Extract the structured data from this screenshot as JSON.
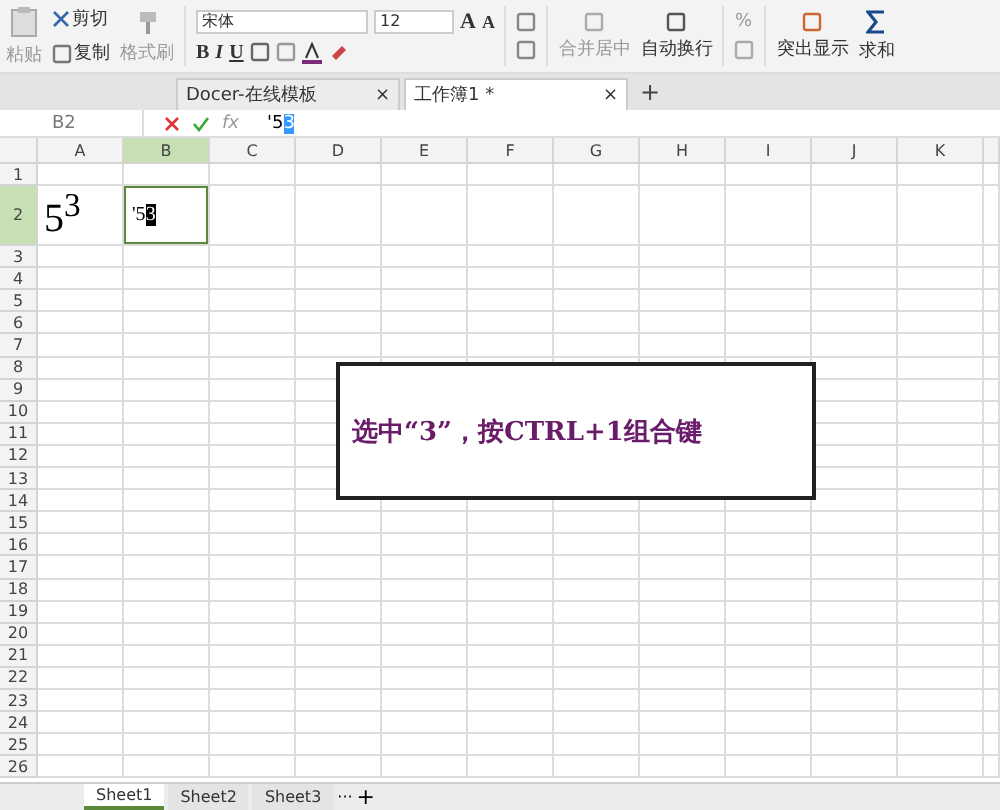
{
  "ribbon": {
    "paste": "粘贴",
    "cut": "剪切",
    "copy": "复制",
    "format_painter": "格式刷",
    "font": "宋体",
    "size": "12",
    "grow": "A",
    "shrink": "A",
    "bold": "B",
    "italic": "I",
    "underline": "U",
    "merge": "合并居中",
    "wrap": "自动换行",
    "percent": "%",
    "highlight": "突出显示",
    "sum": "求和"
  },
  "tabs": [
    {
      "label": "Docer-在线模板",
      "selected": false,
      "close": "×"
    },
    {
      "label": "工作簿1 *",
      "selected": true,
      "close": "×"
    }
  ],
  "new_tab": "+",
  "formula_bar": {
    "cell_ref": "B2",
    "fx": "fx",
    "value": "'5",
    "value_selected": "3"
  },
  "columns": [
    {
      "label": "A",
      "selected": false
    },
    {
      "label": "B",
      "selected": true
    },
    {
      "label": "C",
      "selected": false
    },
    {
      "label": "D",
      "selected": false
    },
    {
      "label": "E",
      "selected": false
    },
    {
      "label": "F",
      "selected": false
    },
    {
      "label": "G",
      "selected": false
    },
    {
      "label": "H",
      "selected": false
    },
    {
      "label": "I",
      "selected": false
    },
    {
      "label": "J",
      "selected": false
    },
    {
      "label": "K",
      "selected": false
    }
  ],
  "rows": [
    {
      "label": "1",
      "selected": false
    },
    {
      "label": "2",
      "selected": true,
      "tall": true,
      "cells": [
        {
          "text": "5$^{3}$",
          "active": false
        },
        {
          "text": "'5",
          "selected_part": "3",
          "active": true
        }
      ]
    },
    {
      "label": "3",
      "selected": false
    },
    {
      "label": "4",
      "selected": false
    },
    {
      "label": "5",
      "selected": false
    },
    {
      "label": "6",
      "selected": false
    },
    {
      "label": "7",
      "selected": false
    },
    {
      "label": "8",
      "selected": false
    },
    {
      "label": "9",
      "selected": false
    },
    {
      "label": "10",
      "selected": false
    },
    {
      "label": "11",
      "selected": false
    },
    {
      "label": "12",
      "selected": false
    },
    {
      "label": "13",
      "selected": false
    },
    {
      "label": "14",
      "selected": false
    },
    {
      "label": "15",
      "selected": false
    },
    {
      "label": "16",
      "selected": false
    },
    {
      "label": "17",
      "selected": false
    },
    {
      "label": "18",
      "selected": false
    },
    {
      "label": "19",
      "selected": false
    },
    {
      "label": "20",
      "selected": false
    },
    {
      "label": "21",
      "selected": false
    },
    {
      "label": "22",
      "selected": false
    },
    {
      "label": "23",
      "selected": false
    },
    {
      "label": "24",
      "selected": false
    },
    {
      "label": "25",
      "selected": false
    },
    {
      "label": "26",
      "selected": false
    }
  ],
  "callout": "选中“3”，按CTRL+1组合键",
  "sheet_tabs": [
    {
      "label": "Sheet1",
      "selected": true
    },
    {
      "label": "Sheet2",
      "selected": false
    },
    {
      "label": "Sheet3",
      "selected": false
    }
  ],
  "more_sheets": "···",
  "add_sheet": "+"
}
